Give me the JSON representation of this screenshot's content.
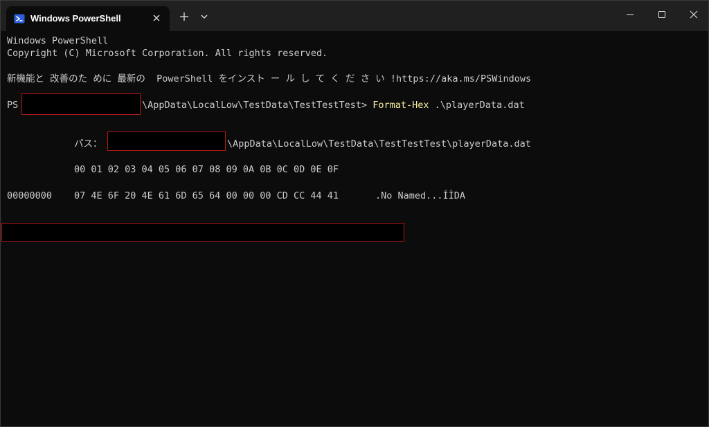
{
  "window": {
    "tab_title": "Windows PowerShell",
    "icons": {
      "tab": "powershell-icon",
      "close_tab": "close-icon",
      "new_tab": "plus-icon",
      "dropdown": "chevron-down-icon",
      "minimize": "minimize-icon",
      "maximize": "maximize-icon",
      "close_window": "close-icon"
    }
  },
  "terminal": {
    "banner_line1": "Windows PowerShell",
    "banner_line2": "Copyright (C) Microsoft Corporation. All rights reserved.",
    "banner_line3": "新機能と 改善のた めに 最新の  PowerShell をインスト ー ル し て く だ さ い !https://aka.ms/PSWindows",
    "prompt_prefix": "PS",
    "prompt_path": "\\AppData\\LocalLow\\TestData\\TestTestTest>",
    "command_name": "Format-Hex",
    "command_arg": " .\\playerData.dat",
    "path_label": "パス：",
    "path_value": "\\AppData\\LocalLow\\TestData\\TestTestTest\\playerData.dat",
    "hex_header": "00 01 02 03 04 05 06 07 08 09 0A 0B 0C 0D 0E 0F",
    "row_offset": "00000000",
    "row_bytes": "07 4E 6F 20 4E 61 6D 65 64 00 00 00 CD CC 44 41",
    "row_ascii": ".No Named...ÍÌDA"
  },
  "colors": {
    "background": "#0c0c0c",
    "titlebar": "#202020",
    "text": "#cccccc",
    "command": "#f9f1a5",
    "redaction_border": "#b01818"
  }
}
